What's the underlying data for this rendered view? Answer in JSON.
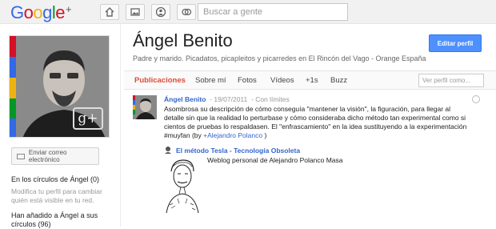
{
  "topbar": {
    "logo_text": "Google",
    "logo_plus": "+",
    "logo_colors": [
      "#3369e8",
      "#d50f25",
      "#eeb211",
      "#3369e8",
      "#009925",
      "#d50f25"
    ],
    "nav_icons": [
      "home-icon",
      "photos-icon",
      "profile-icon",
      "circles-icon"
    ],
    "search_placeholder": "Buscar a gente"
  },
  "profile": {
    "name": "Ángel Benito",
    "tagline": "Padre y marido. Picadatos, picapleitos y picarredes en El Rincón del Vago - Orange España",
    "edit_button": "Editar perfil",
    "photo_badge": "g+",
    "stripe_colors": [
      "#d50f25",
      "#3369e8",
      "#eeb211",
      "#009925",
      "#3369e8"
    ]
  },
  "sidebar": {
    "email_button": "Enviar correo electrónico",
    "circles_heading": "En los círculos de Ángel (0)",
    "circles_hint": "Modifica tu perfil para cambiar quién está visible en tu red.",
    "added_heading": "Han añadido a Ángel a sus círculos (96)"
  },
  "tabs": [
    {
      "label": "Publicaciones",
      "active": true
    },
    {
      "label": "Sobre mí"
    },
    {
      "label": "Fotos"
    },
    {
      "label": "Vídeos"
    },
    {
      "label": "+1s"
    },
    {
      "label": "Buzz"
    }
  ],
  "filter_placeholder": "Ver perfil como...",
  "post": {
    "author": "Ángel Benito",
    "date": "19/07/2011",
    "visibility": "Con límites",
    "body_1": "Asombrosa su descripción de cómo conseguía \"mantener la visión\", la figuración, para llegar al detalle sin que la realidad lo perturbase y cómo consideraba dicho método tan experimental como si cientos de pruebas lo respaldasen. El \"enfrascamiento\" en la idea sustituyendo a la experimentación #muyfan (by ",
    "mention": "+Alejandro Polanco",
    "body_2": " )",
    "link_title": "El método Tesla - Tecnología Obsoleta",
    "link_desc": "Weblog personal de Alejandro Polanco Masa"
  },
  "colors": {
    "accent_red": "#dd4b39",
    "link_blue": "#3366cc",
    "edit_button_blue": "#4d90fe"
  }
}
